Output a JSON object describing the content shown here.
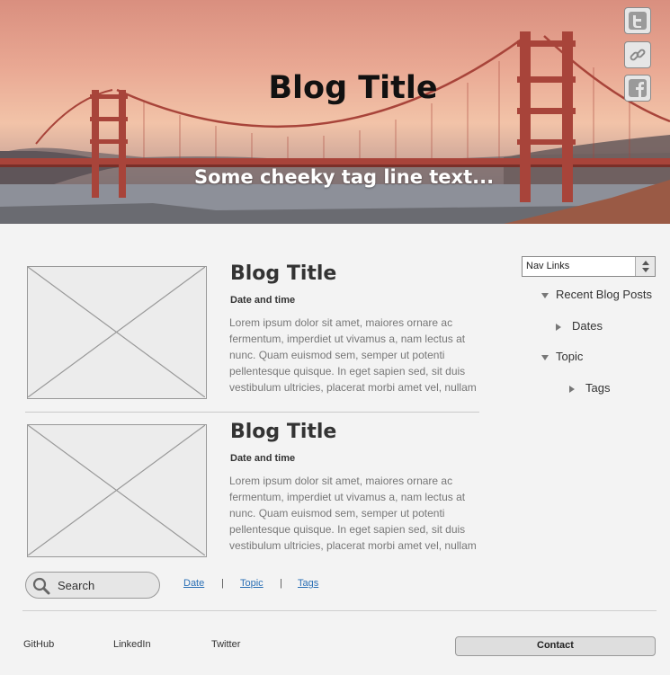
{
  "hero": {
    "title": "Blog Title",
    "tagline": "Some cheeky tag line text..."
  },
  "social": [
    {
      "icon": "twitter-icon"
    },
    {
      "icon": "link-icon"
    },
    {
      "icon": "facebook-icon"
    }
  ],
  "posts": [
    {
      "title": "Blog Title",
      "date": "Date and time",
      "body": "Lorem ipsum dolor sit amet, maiores ornare ac fermentum, imperdiet ut vivamus a, nam lectus at nunc. Quam euismod sem, semper ut potenti pellentesque quisque. In eget sapien sed, sit duis vestibulum ultricies, placerat morbi amet vel, nullam in in lorem vel. In molestie elit dui dictum"
    },
    {
      "title": "Blog Title",
      "date": "Date and time",
      "body": "Lorem ipsum dolor sit amet, maiores ornare ac fermentum, imperdiet ut vivamus a, nam lectus at nunc. Quam euismod sem, semper ut potenti pellentesque quisque. In eget sapien sed, sit duis vestibulum ultricies, placerat morbi amet vel, nullam in in lorem vel. In molestie elit dui dictum"
    }
  ],
  "sidebar": {
    "select_value": "Nav Links",
    "tree": [
      {
        "label": "Recent Blog Posts",
        "expanded": true
      },
      {
        "label": "Dates",
        "expanded": false
      },
      {
        "label": "Topic",
        "expanded": true
      },
      {
        "label": "Tags",
        "expanded": false
      }
    ]
  },
  "search": {
    "label": "Search"
  },
  "filter_links": [
    "Date",
    "Topic",
    "Tags"
  ],
  "filter_separator": "|",
  "footer": {
    "links": [
      "GitHub",
      "LinkedIn",
      "Twitter"
    ],
    "contact_label": "Contact"
  },
  "colors": {
    "link": "#2a6fb5",
    "background": "#f3f3f3",
    "bridge": "#a8443a"
  }
}
